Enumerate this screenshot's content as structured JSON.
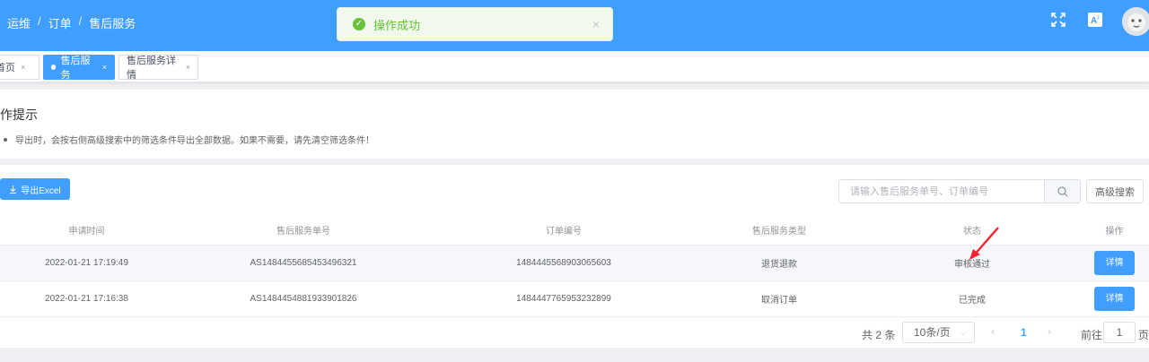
{
  "breadcrumb": [
    "运维",
    "订单",
    "售后服务"
  ],
  "toast": {
    "message": "操作成功",
    "icon": "success-check-icon",
    "close": "×"
  },
  "header_icons": [
    "fullscreen-icon",
    "translate-icon",
    "user-avatar"
  ],
  "tags": [
    {
      "label": "首页",
      "close": "×"
    },
    {
      "label": "售后服务",
      "close": "×"
    },
    {
      "label": "售后服务详情",
      "close": "×"
    }
  ],
  "tips": {
    "title": "操作提示",
    "items": [
      "导出时，会按右侧高级搜索中的筛选条件导出全部数据。如果不需要，请先清空筛选条件！"
    ]
  },
  "toolbar": {
    "export_label": "导出Excel",
    "search_placeholder": "请输入售后服务单号、订单编号",
    "advanced_label": "高级搜索"
  },
  "table": {
    "headers": [
      "申请时间",
      "售后服务单号",
      "订单编号",
      "售后服务类型",
      "状态",
      "操作"
    ],
    "rows": [
      {
        "time": "2022-01-21 17:19:49",
        "service_no": "AS1484455685453496321",
        "order_no": "1484445568903065603",
        "type": "退货退款",
        "status": "审核通过",
        "action": "详情"
      },
      {
        "time": "2022-01-21 17:16:38",
        "service_no": "AS1484454881933901826",
        "order_no": "1484447765953232899",
        "type": "取消订单",
        "status": "已完成",
        "action": "详情"
      }
    ]
  },
  "pagination": {
    "total": "共 2 条",
    "page_size": "10条/页",
    "current_page": "1",
    "goto_label": "前往",
    "goto_value": "1",
    "unit": "页"
  },
  "colors": {
    "primary": "#409eff",
    "success": "#67c23a",
    "annotation": "#f5222d"
  }
}
